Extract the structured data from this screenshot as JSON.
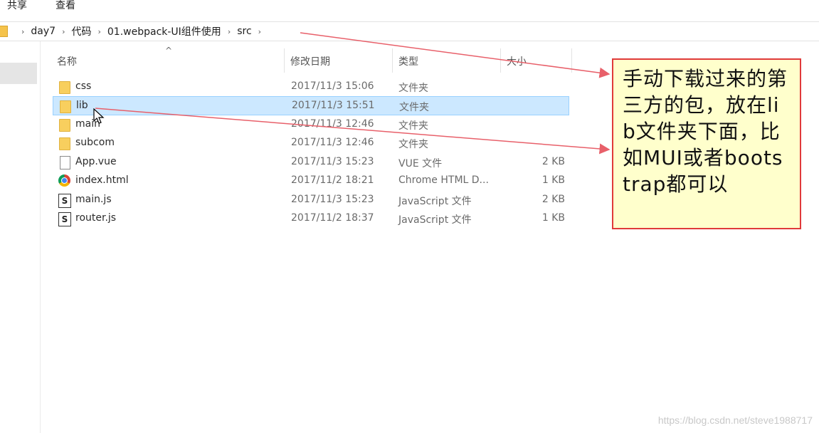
{
  "ribbon": {
    "tabs": [
      "共享",
      "查看"
    ]
  },
  "address": {
    "crumbs": [
      "day7",
      "代码",
      "01.webpack-UI组件使用",
      "src"
    ]
  },
  "columns": {
    "name": "名称",
    "date": "修改日期",
    "type": "类型",
    "size": "大小"
  },
  "files": [
    {
      "icon": "folder-icon",
      "name": "css",
      "date": "2017/11/3 15:06",
      "type": "文件夹",
      "size": ""
    },
    {
      "icon": "folder-icon",
      "name": "lib",
      "date": "2017/11/3 15:51",
      "type": "文件夹",
      "size": "",
      "selected": true
    },
    {
      "icon": "folder-icon",
      "name": "main",
      "date": "2017/11/3 12:46",
      "type": "文件夹",
      "size": ""
    },
    {
      "icon": "folder-icon",
      "name": "subcom",
      "date": "2017/11/3 12:46",
      "type": "文件夹",
      "size": ""
    },
    {
      "icon": "file-icon",
      "name": "App.vue",
      "date": "2017/11/3 15:23",
      "type": "VUE 文件",
      "size": "2 KB"
    },
    {
      "icon": "chrome-icon",
      "name": "index.html",
      "date": "2017/11/2 18:21",
      "type": "Chrome HTML D...",
      "size": "1 KB"
    },
    {
      "icon": "script-icon",
      "name": "main.js",
      "date": "2017/11/3 15:23",
      "type": "JavaScript 文件",
      "size": "2 KB"
    },
    {
      "icon": "script-icon",
      "name": "router.js",
      "date": "2017/11/2 18:37",
      "type": "JavaScript 文件",
      "size": "1 KB"
    }
  ],
  "annotation": {
    "text": "手动下载过来的第三方的包，放在lib文件夹下面，比如MUI或者bootstrap都可以"
  },
  "colors": {
    "selected_bg": "#cce8ff",
    "note_bg": "#ffffcc",
    "note_border": "#e03a3a",
    "folder": "#f8cf5e"
  },
  "watermark": "https://blog.csdn.net/steve1988717"
}
